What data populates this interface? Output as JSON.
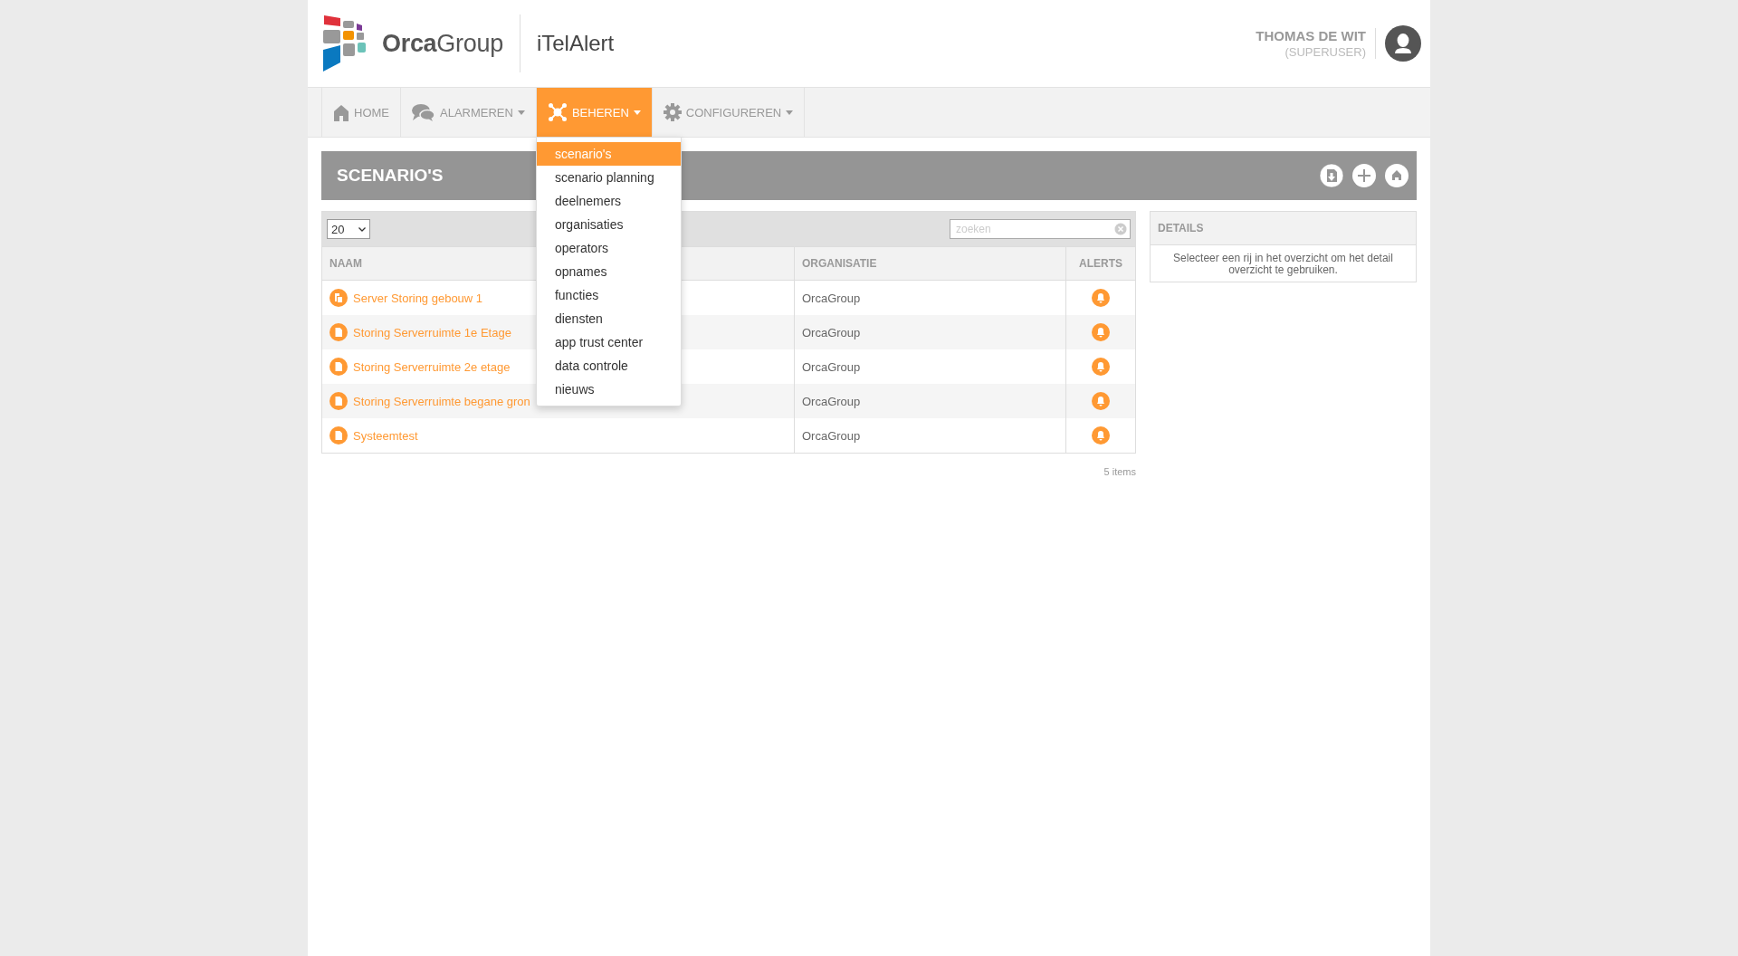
{
  "header": {
    "logo_text": "**Orca**Group",
    "app_name": "iTelAlert",
    "user_name": "THOMAS DE WIT",
    "user_role": "(SUPERUSER)"
  },
  "nav": [
    {
      "kind": "home",
      "label": "HOME",
      "has_caret": false,
      "selected": false
    },
    {
      "kind": "chat",
      "label": "ALARMEREN",
      "has_caret": true,
      "selected": false
    },
    {
      "kind": "network",
      "label": "BEHEREN",
      "has_caret": true,
      "selected": true,
      "menu": [
        {
          "label": "scenario's",
          "selected": true
        },
        {
          "label": "scenario planning",
          "selected": false
        },
        {
          "label": "deelnemers",
          "selected": false
        },
        {
          "label": "organisaties",
          "selected": false
        },
        {
          "label": "operators",
          "selected": false
        },
        {
          "label": "opnames",
          "selected": false
        },
        {
          "label": "functies",
          "selected": false
        },
        {
          "label": "diensten",
          "selected": false
        },
        {
          "label": "app trust center",
          "selected": false
        },
        {
          "label": "data controle",
          "selected": false
        },
        {
          "label": "nieuws",
          "selected": false
        }
      ]
    },
    {
      "kind": "gear",
      "label": "CONFIGUREREN",
      "has_caret": true,
      "selected": false
    }
  ],
  "page_title": "SCENARIO'S",
  "table": {
    "page_size": "20",
    "search_placeholder": "zoeken",
    "columns": [
      "NAAM",
      "ORGANISATIE",
      "ALERTS"
    ],
    "rows": [
      {
        "kind": "multi",
        "name": "Server Storing gebouw 1",
        "organisation": "OrcaGroup"
      },
      {
        "kind": "single",
        "name": "Storing Serverruimte 1e Etage",
        "organisation": "OrcaGroup"
      },
      {
        "kind": "single",
        "name": "Storing Serverruimte 2e etage",
        "organisation": "OrcaGroup"
      },
      {
        "kind": "single",
        "name": "Storing Serverruimte begane gron",
        "organisation": "OrcaGroup"
      },
      {
        "kind": "single",
        "name": "Systeemtest",
        "organisation": "OrcaGroup"
      }
    ],
    "count": "5 items"
  },
  "details": {
    "title": "DETAILS",
    "message": "Selecteer een rij in het overzicht om het detail overzicht te gebruiken."
  }
}
